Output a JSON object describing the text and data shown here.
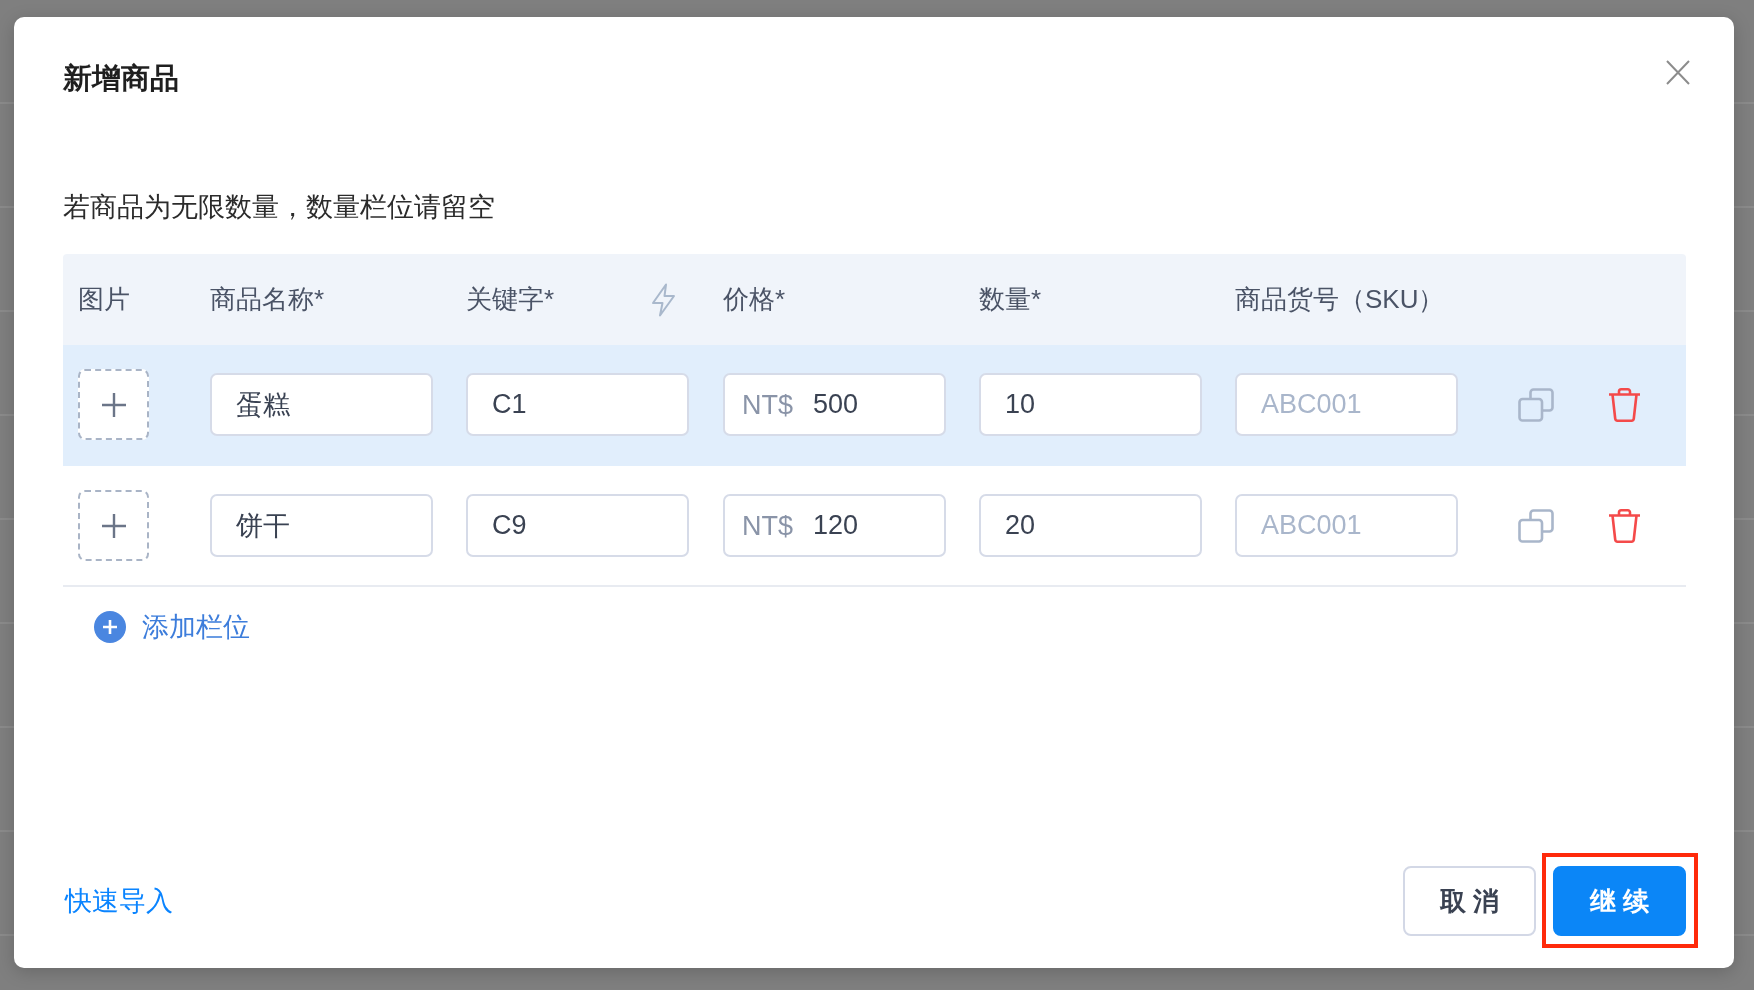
{
  "dialog": {
    "title": "新增商品",
    "note": "若商品为无限数量，数量栏位请留空"
  },
  "table": {
    "columns": [
      {
        "label": "图片",
        "has_icon": false
      },
      {
        "label": "商品名称*",
        "has_icon": false
      },
      {
        "label": "关键字*",
        "has_icon": true
      },
      {
        "label": "价格*",
        "has_icon": false
      },
      {
        "label": "数量*",
        "has_icon": false
      },
      {
        "label": "商品货号（SKU）",
        "has_icon": false
      }
    ],
    "rows": [
      {
        "selected": true,
        "name": "蛋糕",
        "keyword": "C1",
        "price_prefix": "NT$",
        "price": "500",
        "quantity": "10",
        "sku_placeholder": "ABC001"
      },
      {
        "selected": false,
        "name": "饼干",
        "keyword": "C9",
        "price_prefix": "NT$",
        "price": "120",
        "quantity": "20",
        "sku_placeholder": "ABC001"
      }
    ]
  },
  "add_row_label": "添加栏位",
  "footer": {
    "quick_import": "快速导入",
    "buttons": [
      {
        "label": "取 消",
        "kind": "secondary",
        "annotated": false
      },
      {
        "label": "继 续",
        "kind": "primary",
        "annotated": true
      }
    ]
  }
}
